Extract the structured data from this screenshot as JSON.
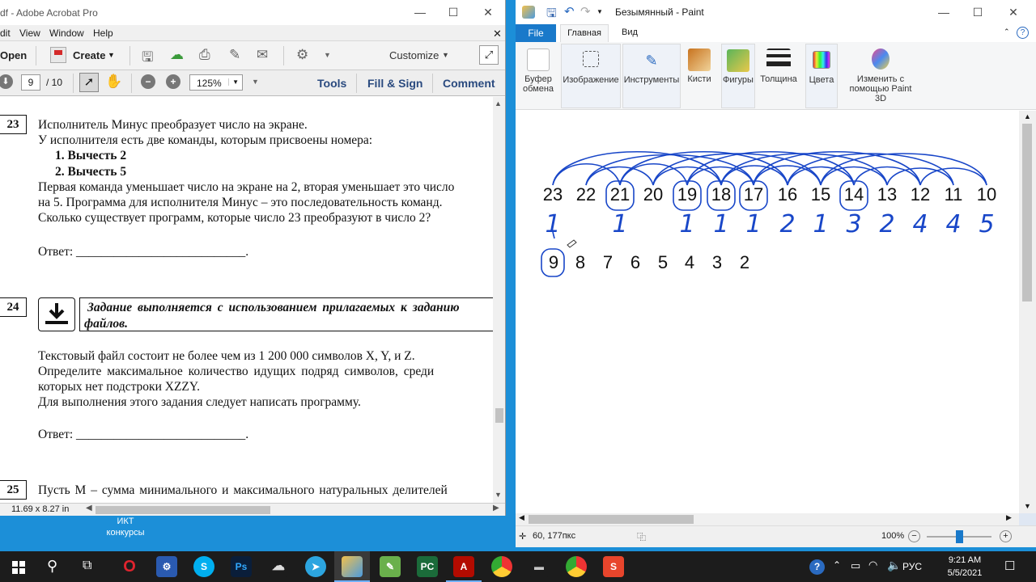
{
  "acrobat": {
    "title": "df - Adobe Acrobat Pro",
    "menu": [
      "dit",
      "View",
      "Window",
      "Help"
    ],
    "toolbar": {
      "open": "Open",
      "create": "Create",
      "customize": "Customize"
    },
    "nav": {
      "page": "9",
      "of": "/ 10",
      "zoom": "125%",
      "tools": "Tools",
      "fill_sign": "Fill & Sign",
      "comment": "Comment"
    },
    "doc": {
      "q23": {
        "num": "23",
        "lines": [
          "Исполнитель Минус преобразует число на экране.",
          "У исполнителя есть две команды, которым присвоены номера:"
        ],
        "cmds": [
          "1. Вычесть 2",
          "2. Вычесть 5"
        ],
        "para": [
          "Первая команда уменьшает число на экране на 2, вторая уменьшает это число",
          "на 5. Программа для исполнителя Минус – это последовательность команд.",
          "Сколько существует программ, которые число 23 преобразуют в число 2?"
        ],
        "answer": "Ответ: ___________________________."
      },
      "q24": {
        "num": "24",
        "note": [
          "Задание выполняется с использованием прилагаемых к заданию",
          "файлов."
        ],
        "para": [
          "Текстовый файл состоит не более чем из 1 200 000 символов X, Y, и Z.",
          "Определите максимальное количество идущих подряд символов, среди",
          "которых нет подстроки XZZY.",
          "Для выполнения этого задания следует написать программу."
        ],
        "answer": "Ответ: ___________________________."
      },
      "q25": {
        "num": "25",
        "line": "Пусть M – сумма минимального и максимального натуральных делителей"
      }
    },
    "status": "11.69 x 8.27 in"
  },
  "desktop": {
    "icon_label": [
      "ИКТ",
      "конкурсы"
    ]
  },
  "paint": {
    "title": "Безымянный - Paint",
    "tabs": [
      "File",
      "Главная",
      "Вид"
    ],
    "groups": [
      "Буфер обмена",
      "Изображение",
      "Инструменты",
      "Кисти",
      "Фигуры",
      "Толщина",
      "Цвета",
      "Изменить с помощью Paint 3D"
    ],
    "canvas": {
      "row1": [
        "23",
        "22",
        "21",
        "20",
        "19",
        "18",
        "17",
        "16",
        "15",
        "14",
        "13",
        "12",
        "11",
        "10"
      ],
      "counts": [
        "1",
        "",
        "1",
        "",
        "1",
        "1",
        "1",
        "2",
        "1",
        "3",
        "2",
        "4",
        "4",
        "5"
      ],
      "row2": [
        "9",
        "8",
        "7",
        "6",
        "5",
        "4",
        "3",
        "2"
      ]
    },
    "status": {
      "pos": "60, 177пкс",
      "zoom": "100%"
    }
  },
  "taskbar": {
    "lang": "РУС",
    "time": "9:21 AM",
    "date": "5/5/2021"
  },
  "colors": {
    "accent": "#1c8fd8",
    "ink": "#1846c8",
    "file_tab": "#1979ca"
  }
}
